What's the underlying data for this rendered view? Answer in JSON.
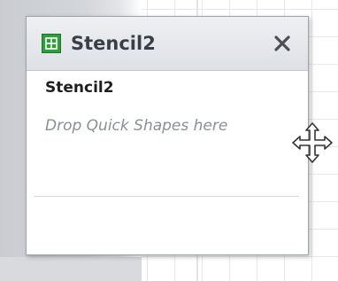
{
  "stencil_window": {
    "title": "Stencil2",
    "stencil_name": "Stencil2",
    "drop_hint": "Drop Quick Shapes here",
    "close_icon": "close-icon",
    "stencil_icon": "stencil-icon"
  },
  "cursor": {
    "type": "move-cursor-icon"
  },
  "colors": {
    "stencil_icon_green": "#2e9e3a",
    "title_bar_bg": "#e6e8ec",
    "title_text": "#3a3f47",
    "hint_text": "#8a8f96"
  }
}
